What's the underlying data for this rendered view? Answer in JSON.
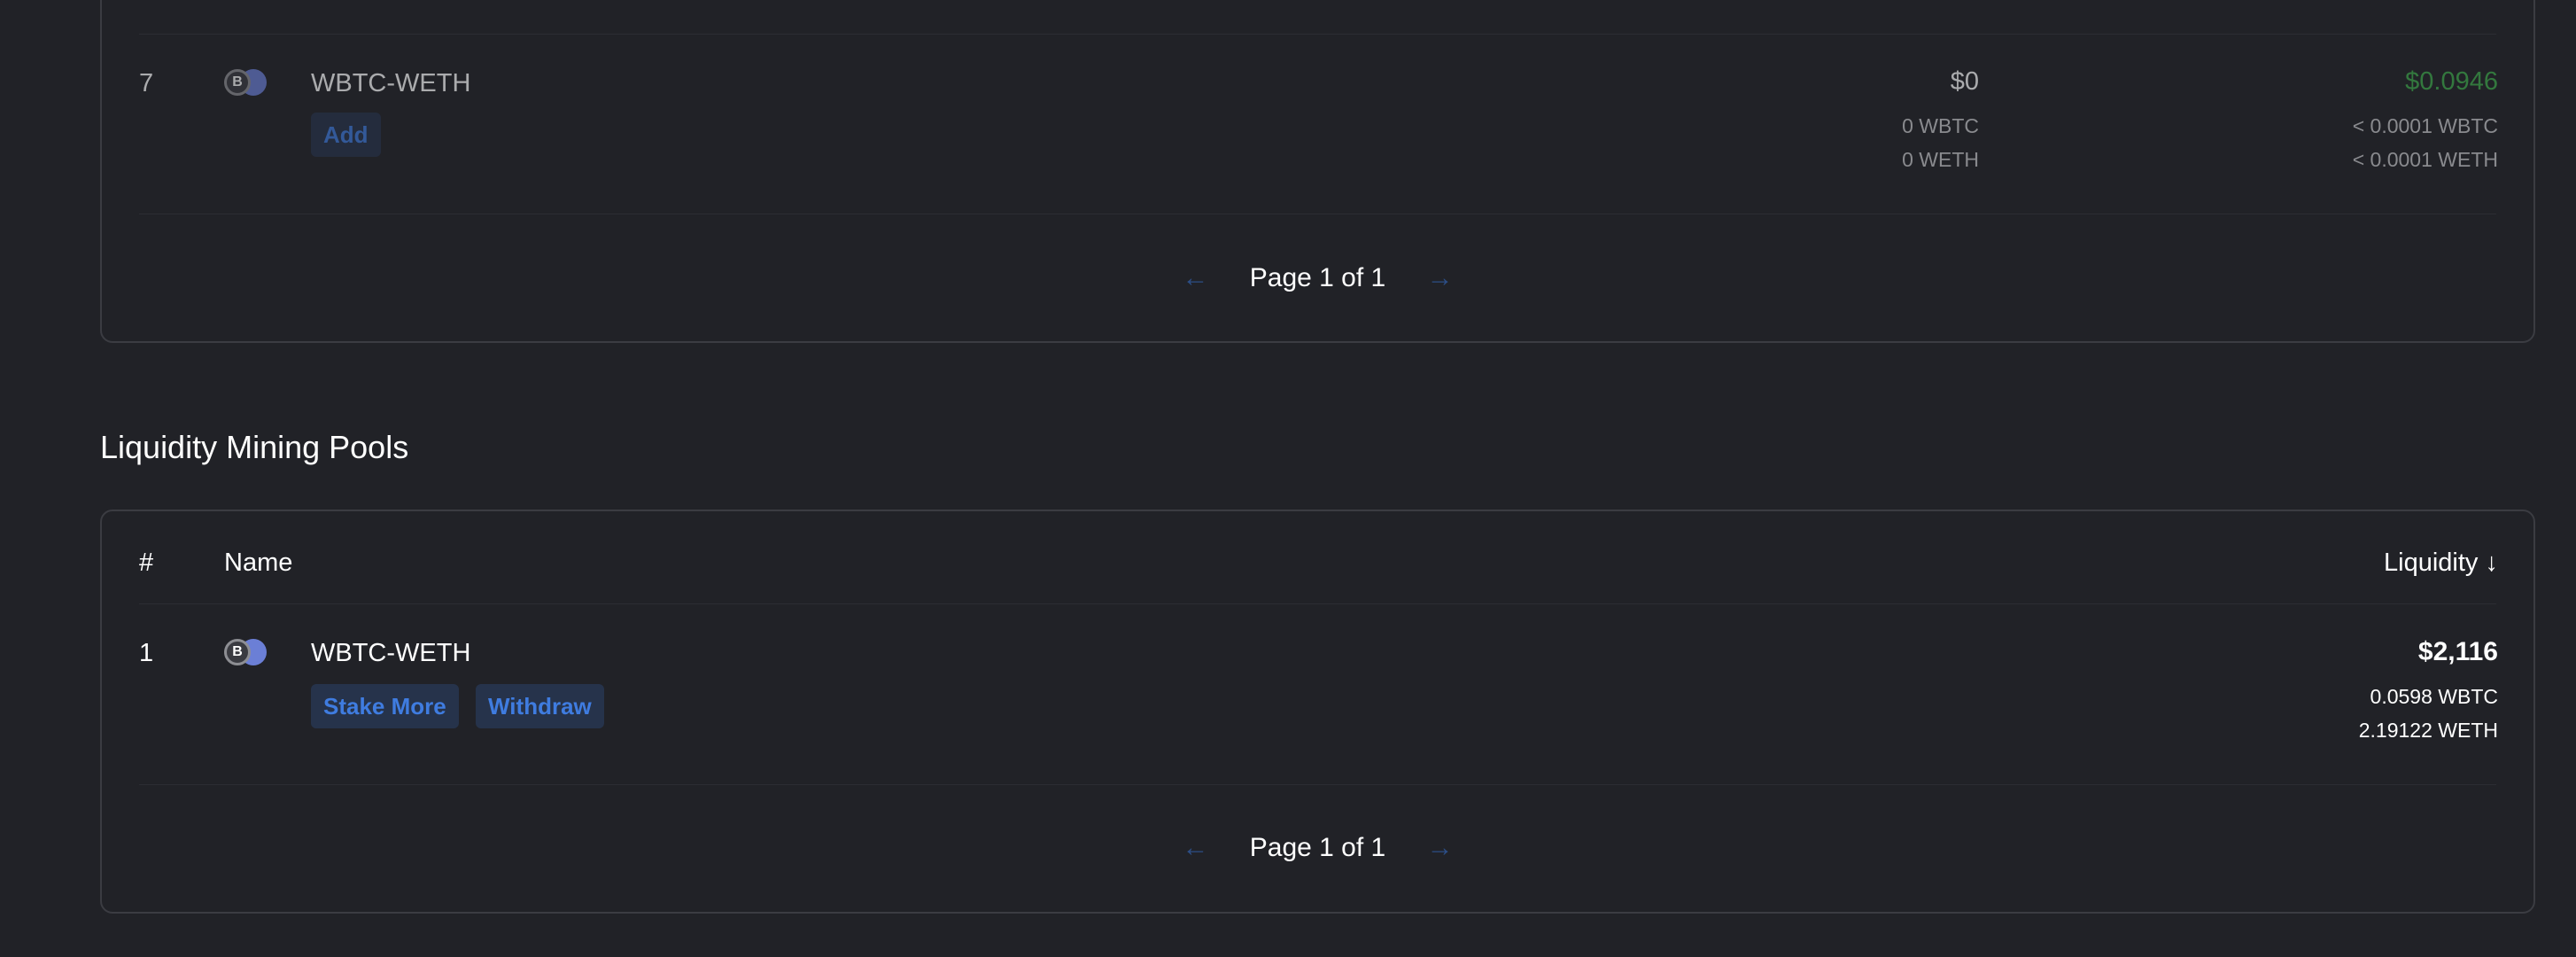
{
  "top_table": {
    "row": {
      "rank": "7",
      "pair": "WBTC-WETH",
      "coin_a_glyph": "B",
      "add_label": "Add",
      "value": "$0",
      "value_token_a": "0 WBTC",
      "value_token_b": "0 WETH",
      "fees": "$0.0946",
      "fees_token_a": "< 0.0001 WBTC",
      "fees_token_b": "< 0.0001 WETH"
    },
    "pagination": {
      "prev_glyph": "←",
      "label": "Page 1 of 1",
      "next_glyph": "→"
    }
  },
  "mining_section": {
    "title": "Liquidity Mining Pools",
    "headers": {
      "rank": "#",
      "name": "Name",
      "liquidity": "Liquidity ↓"
    },
    "row": {
      "rank": "1",
      "pair": "WBTC-WETH",
      "coin_a_glyph": "B",
      "stake_more_label": "Stake More",
      "withdraw_label": "Withdraw",
      "liquidity": "$2,116",
      "token_a": "0.0598 WBTC",
      "token_b": "2.19122 WETH"
    },
    "pagination": {
      "prev_glyph": "←",
      "label": "Page 1 of 1",
      "next_glyph": "→"
    }
  },
  "colors": {
    "background": "#212227",
    "border": "#3b3c42",
    "button_bg": "#26334b",
    "button_text": "#3f7ce0",
    "positive": "#2f8a3c"
  },
  "icons": [
    "wbtc-coin-icon",
    "weth-coin-icon",
    "arrow-left-icon",
    "arrow-right-icon",
    "sort-down-icon"
  ]
}
